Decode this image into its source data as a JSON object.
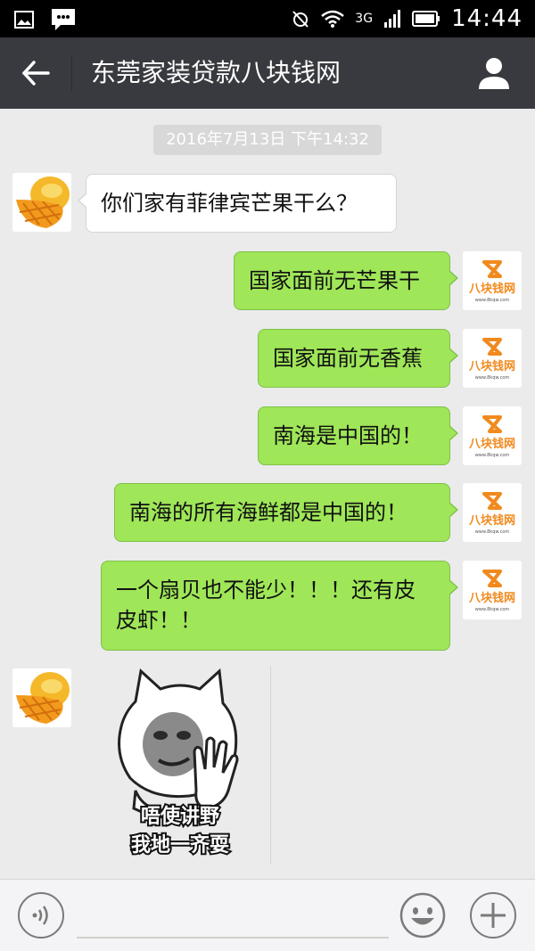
{
  "status_bar": {
    "time": "14:44",
    "network": "3G"
  },
  "header": {
    "title": "东莞家装贷款八块钱网"
  },
  "chat": {
    "timestamp": "2016年7月13日  下午14:32",
    "messages": [
      {
        "side": "left",
        "text": "你们家有菲律宾芒果干么？"
      },
      {
        "side": "right",
        "text": "国家面前无芒果干"
      },
      {
        "side": "right",
        "text": "国家面前无香蕉"
      },
      {
        "side": "right",
        "text": "南海是中国的！"
      },
      {
        "side": "right",
        "text": "南海的所有海鲜都是中国的！"
      },
      {
        "side": "right",
        "text": "一个扇贝也不能少！！！还有皮皮虾！！"
      }
    ],
    "sticker": {
      "line1": "唔使讲野",
      "line2": "我地一齐耍"
    },
    "brand_avatar": {
      "name": "八块钱网",
      "url": "www.8kqw.com"
    }
  },
  "colors": {
    "bubble_green": "#9fe658",
    "titlebar": "#393a3f",
    "chat_bg": "#ebebeb",
    "brand_orange": "#f08a1e"
  },
  "input": {
    "placeholder": ""
  }
}
